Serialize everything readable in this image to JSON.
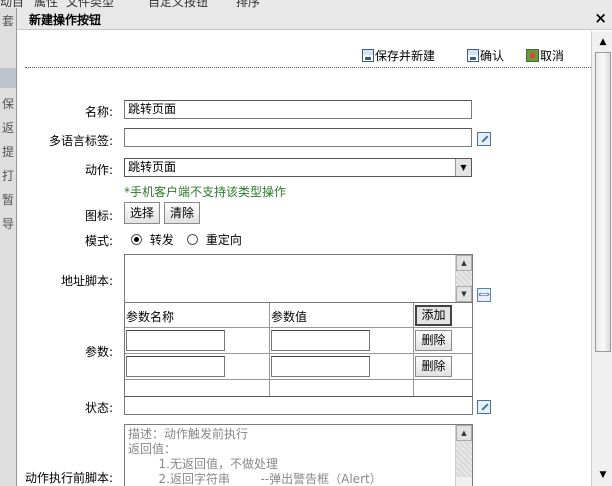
{
  "background": {
    "top_items": [
      "动目",
      "属性",
      "文件类型",
      "",
      "自定义按钮",
      "排序"
    ],
    "left_items": [
      "套",
      "保",
      "返",
      "提",
      "打",
      "暂",
      "导"
    ]
  },
  "dialog": {
    "title": "新建操作按钮",
    "close_glyph": "×"
  },
  "toolbar": {
    "save_new_label": "保存并新建",
    "confirm_label": "确认",
    "cancel_label": "取消"
  },
  "form": {
    "name_label": "名称:",
    "name_value": "跳转页面",
    "multilang_label": "多语言标签:",
    "multilang_value": "",
    "action_label": "动作:",
    "action_value": "跳转页面",
    "action_hint": "*手机客户端不支持该类型操作",
    "icon_label": "图标:",
    "icon_select_button": "选择",
    "icon_clear_button": "清除",
    "mode_label": "模式:",
    "mode_options": [
      "转发",
      "重定向"
    ],
    "mode_selected": "转发",
    "address_script_label": "地址脚本:",
    "params_label": "参数:",
    "params_header_name": "参数名称",
    "params_header_value": "参数值",
    "params_add_button": "添加",
    "params_delete_button": "删除",
    "status_label": "状态:",
    "pre_script_label": "动作执行前脚本:",
    "pre_script_text": [
      "描述：动作触发前执行",
      "返回值：",
      "        1.无返回值，不做处理",
      "        2.返回字符串        --弹出警告框（Alert）"
    ]
  }
}
